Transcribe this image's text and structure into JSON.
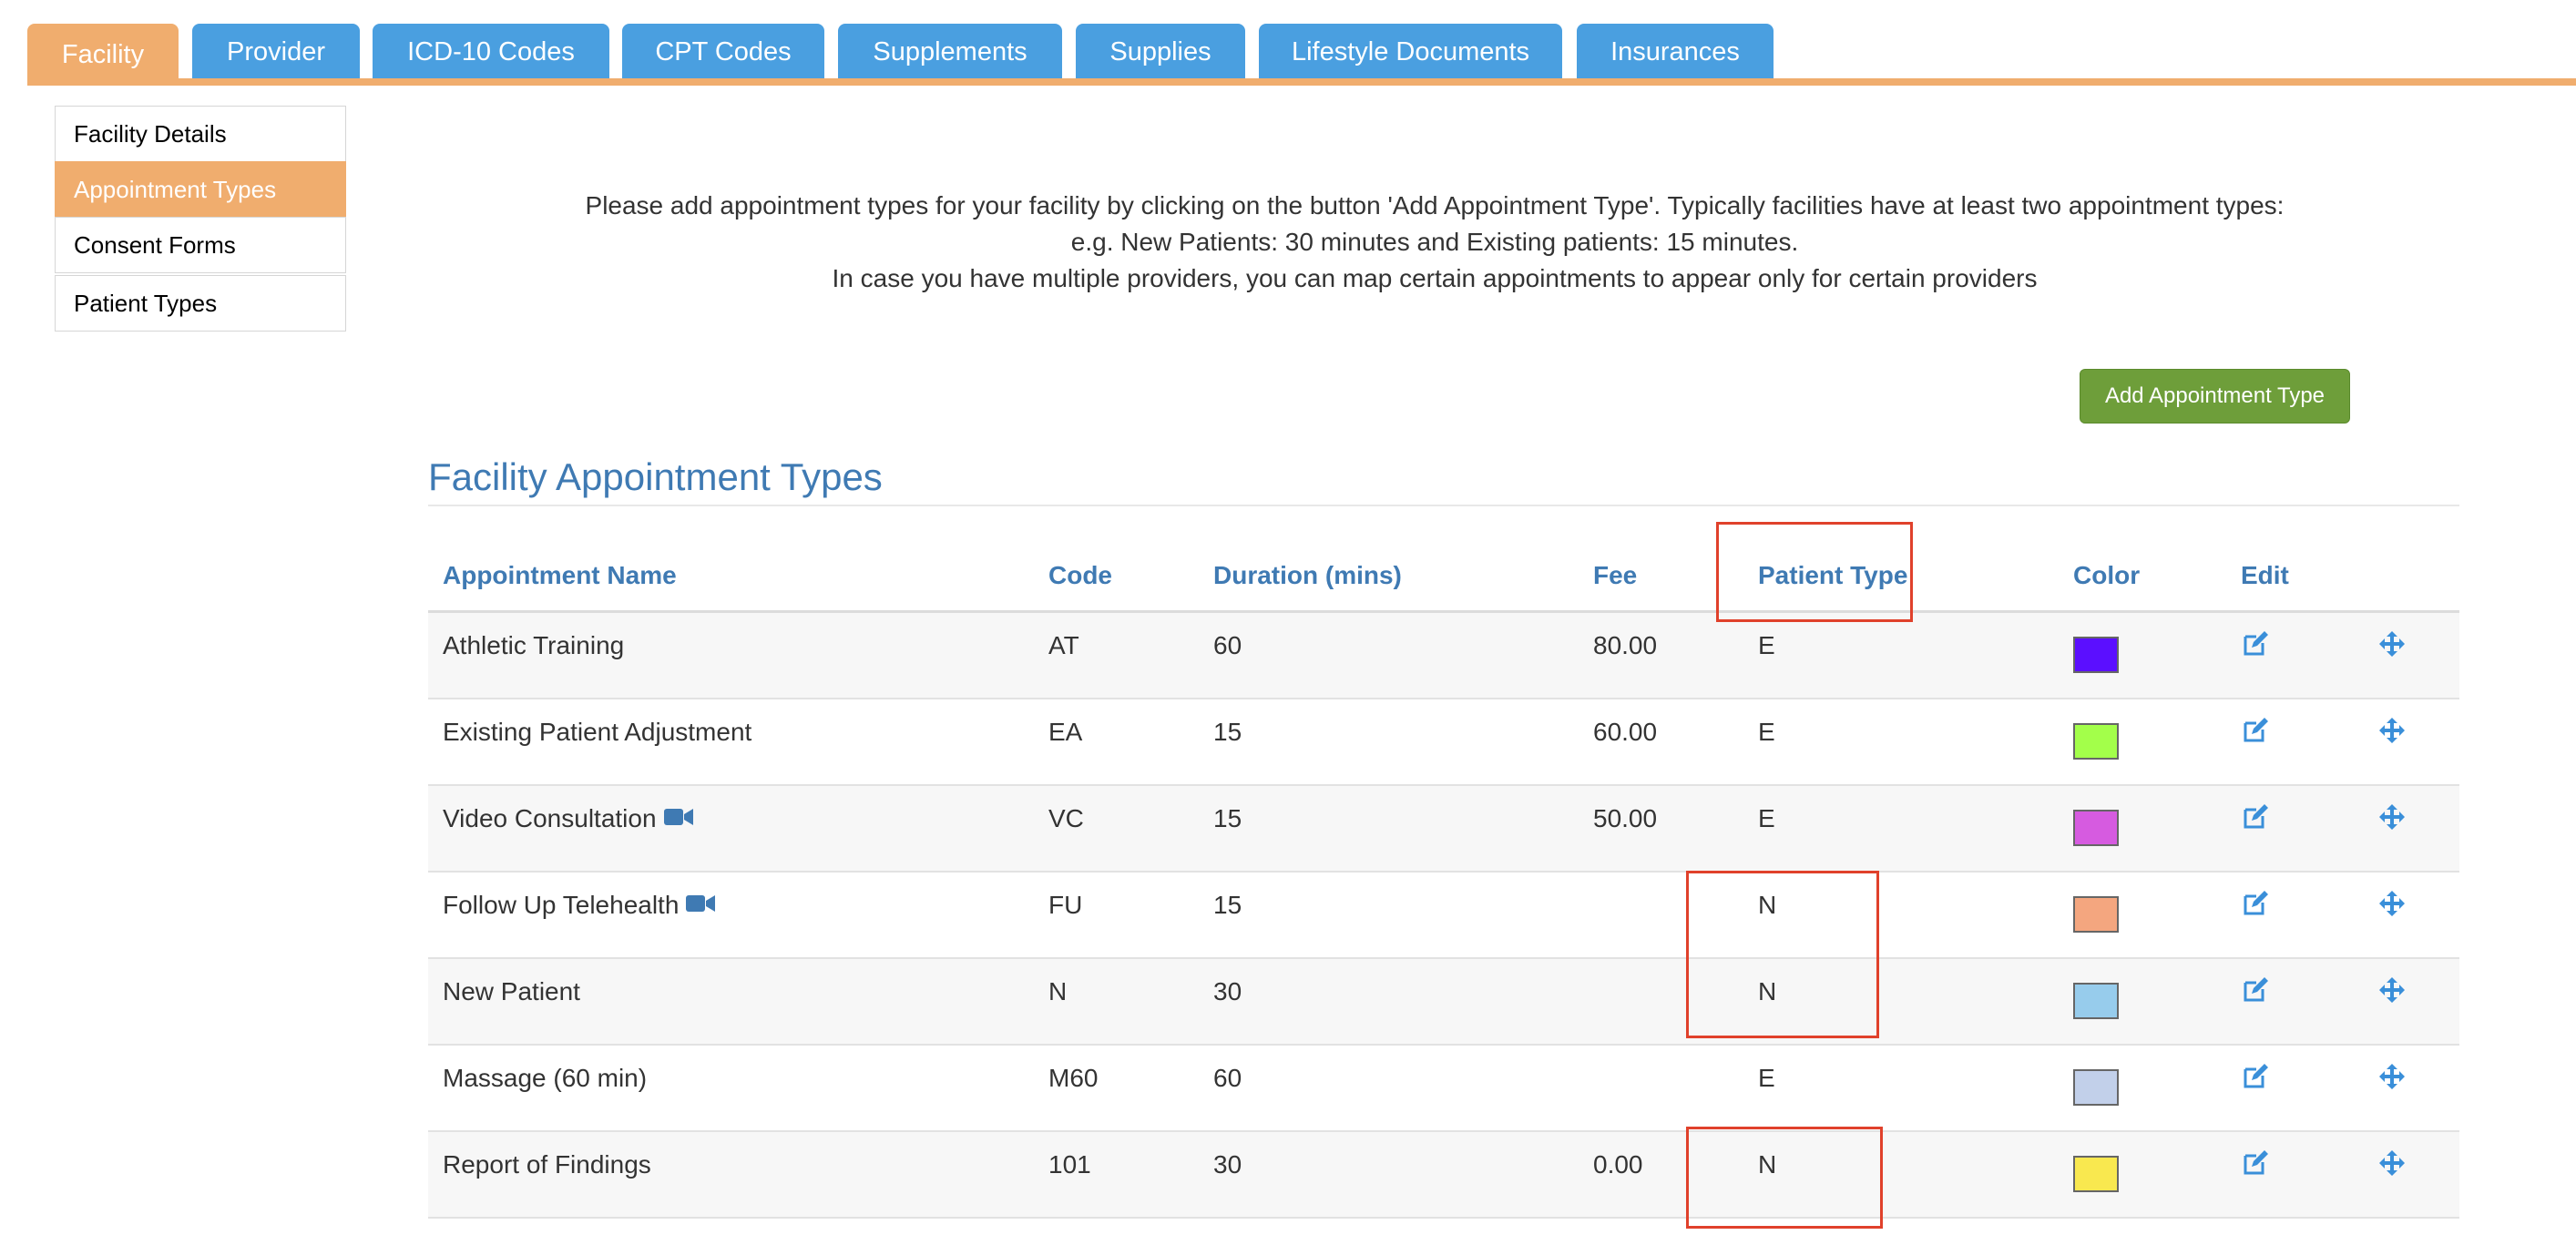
{
  "tabs": [
    {
      "label": "Facility",
      "active": true
    },
    {
      "label": "Provider",
      "active": false
    },
    {
      "label": "ICD-10 Codes",
      "active": false
    },
    {
      "label": "CPT Codes",
      "active": false
    },
    {
      "label": "Supplements",
      "active": false
    },
    {
      "label": "Supplies",
      "active": false
    },
    {
      "label": "Lifestyle Documents",
      "active": false
    },
    {
      "label": "Insurances",
      "active": false
    }
  ],
  "sidebar": {
    "items": [
      {
        "label": "Facility Details"
      },
      {
        "label": "Appointment Types"
      },
      {
        "label": "Consent Forms"
      },
      {
        "label": "Patient Types"
      }
    ]
  },
  "intro": {
    "line1": "Please add appointment types for your facility by clicking on the button 'Add Appointment Type'. Typically facilities have at least two appointment types:",
    "line2": "e.g. New Patients: 30 minutes and Existing patients: 15 minutes.",
    "line3": "In case you have multiple providers, you can map certain appointments to appear only for certain providers"
  },
  "add_button_label": "Add Appointment Type",
  "section_title": "Facility Appointment Types",
  "table": {
    "headers": {
      "name": "Appointment Name",
      "code": "Code",
      "duration": "Duration (mins)",
      "fee": "Fee",
      "patient_type": "Patient Type",
      "color": "Color",
      "edit": "Edit"
    },
    "rows": [
      {
        "name": "Athletic Training",
        "video": false,
        "code": "AT",
        "duration": "60",
        "fee": "80.00",
        "patient_type": "E",
        "color": "#5b0fff"
      },
      {
        "name": "Existing Patient Adjustment",
        "video": false,
        "code": "EA",
        "duration": "15",
        "fee": "60.00",
        "patient_type": "E",
        "color": "#a3ff4a"
      },
      {
        "name": "Video Consultation",
        "video": true,
        "code": "VC",
        "duration": "15",
        "fee": "50.00",
        "patient_type": "E",
        "color": "#d65be0"
      },
      {
        "name": "Follow Up Telehealth",
        "video": true,
        "code": "FU",
        "duration": "15",
        "fee": "",
        "patient_type": "N",
        "color": "#f4a67f"
      },
      {
        "name": "New Patient",
        "video": false,
        "code": "N",
        "duration": "30",
        "fee": "",
        "patient_type": "N",
        "color": "#97ccec"
      },
      {
        "name": "Massage (60 min)",
        "video": false,
        "code": "M60",
        "duration": "60",
        "fee": "",
        "patient_type": "E",
        "color": "#c2d0ea"
      },
      {
        "name": "Report of Findings",
        "video": false,
        "code": "101",
        "duration": "30",
        "fee": "0.00",
        "patient_type": "N",
        "color": "#f9e84f"
      }
    ]
  },
  "colors": {
    "tab_active": "#f0ad6e",
    "tab_inactive": "#4a9fe0",
    "header_text": "#3f7ab3",
    "button_green": "#6e9e3a",
    "highlight_red": "#e0412b"
  }
}
